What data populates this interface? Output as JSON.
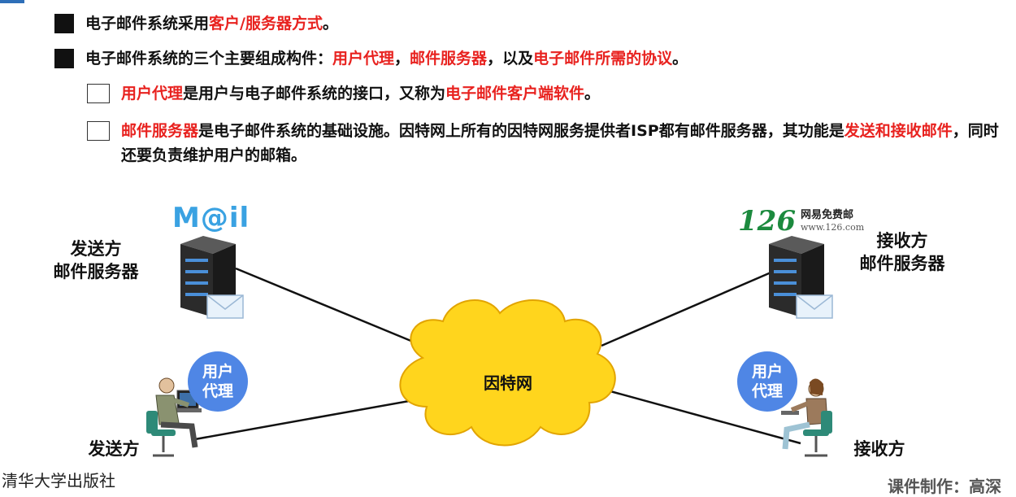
{
  "bullets": {
    "b1": {
      "part1": "电子邮件系统采用",
      "part2": "客户/服务器方式",
      "part3": "。"
    },
    "b2": {
      "part1": "电子邮件系统的三个主要组成构件：",
      "part2": "用户代理",
      "part3": "，",
      "part4": "邮件服务器",
      "part5": "，以及",
      "part6": "电子邮件所需的协议",
      "part7": "。"
    },
    "b3": {
      "part1": "用户代理",
      "part2": "是用户与电子邮件系统的接口，又称为",
      "part3": "电子邮件客户端软件",
      "part4": "。"
    },
    "b4": {
      "part1": "邮件服务器",
      "part2": "是电子邮件系统的基础设施。因特网上所有的因特网服务提供者ISP都有邮件服务器，其功能是",
      "part3": "发送和接收邮件",
      "part4": "，同时还要负责维护用户的邮箱。"
    }
  },
  "diagram": {
    "sender_server_label_1": "发送方",
    "sender_server_label_2": "邮件服务器",
    "receiver_server_label_1": "接收方",
    "receiver_server_label_2": "邮件服务器",
    "sender_label": "发送方",
    "receiver_label": "接收方",
    "cloud_label": "因特网",
    "user_agent_line1": "用户",
    "user_agent_line2": "代理",
    "mail_logo": "M@il",
    "logo126_num": "126",
    "logo126_cn": "网易免费邮",
    "logo126_url": "www.126.com"
  },
  "footer": {
    "publisher": "清华大学出版社",
    "credit": "课件制作：高深"
  },
  "colors": {
    "accent_red": "#e8221f",
    "cloud": "#ffd51d",
    "badge": "#4f86e5"
  }
}
